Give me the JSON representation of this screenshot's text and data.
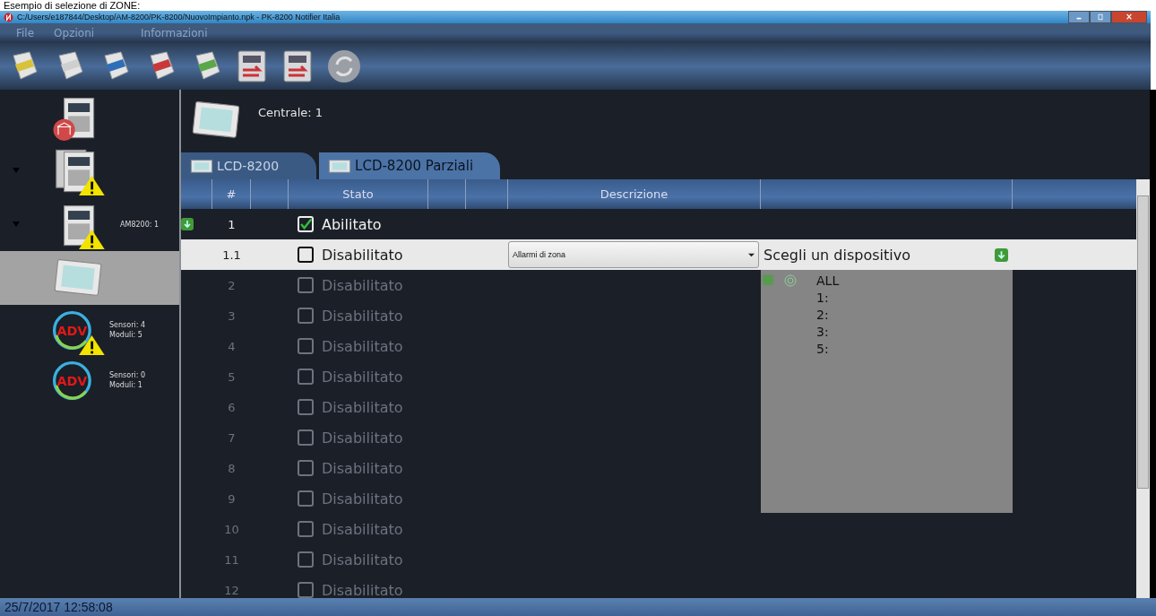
{
  "caption": "Esempio di selezione di ZONE:",
  "window": {
    "title": "C:/Users/e187844/Desktop/AM-8200/PK-8200/NuovoImpianto.npk - PK-8200 Notifier Italia"
  },
  "menu": [
    "File",
    "Opzioni",
    "Informazioni"
  ],
  "toolbar": [
    {
      "kind": "envelope"
    },
    {
      "kind": "probe"
    },
    {
      "kind": "disk"
    },
    {
      "kind": "pdf"
    },
    {
      "kind": "xls"
    },
    {
      "kind": "upload"
    },
    {
      "kind": "download"
    },
    {
      "kind": "sync"
    }
  ],
  "sidebar": {
    "items": [
      {
        "kind": "site",
        "warning": false,
        "expanded": false,
        "selected": false
      },
      {
        "kind": "rack",
        "warning": true,
        "expanded": true,
        "selected": false
      },
      {
        "kind": "panel",
        "warning": true,
        "expanded": true,
        "selected": false,
        "label": "AM8200: 1"
      },
      {
        "kind": "lcd",
        "warning": false,
        "expanded": false,
        "selected": true
      },
      {
        "kind": "adv",
        "icon_text": "ADV",
        "warning": true,
        "expanded": false,
        "selected": false,
        "lines": [
          "Sensori: 4",
          "Moduli: 5"
        ]
      },
      {
        "kind": "adv",
        "icon_text": "ADV",
        "warning": false,
        "expanded": false,
        "selected": false,
        "lines": [
          "Sensori: 0",
          "Moduli: 1"
        ]
      }
    ]
  },
  "header": {
    "title": "Centrale: 1"
  },
  "tabs": [
    {
      "label": "LCD-8200",
      "selected": false
    },
    {
      "label": "LCD-8200 Parziali",
      "selected": true
    }
  ],
  "table": {
    "columns": [
      {
        "label": "#"
      },
      {
        "label": "Stato"
      },
      {
        "label": "Descrizione"
      }
    ],
    "rows": [
      {
        "kind": "zone",
        "number": "1",
        "checked": true,
        "status": "Abilitato",
        "selected": false,
        "dimmed": false
      },
      {
        "kind": "detail",
        "number": "1.1",
        "checked": false,
        "status": "Disabilitato",
        "selected": true,
        "dimmed": false,
        "dropdown": {
          "value": "Allarmi di zona"
        },
        "chooser": {
          "label": "Scegli un dispositivo",
          "options": [
            "ALL",
            "1:",
            "2:",
            "3:",
            "5:"
          ]
        }
      },
      {
        "kind": "plain",
        "number": "2",
        "checked": false,
        "status": "Disabilitato",
        "selected": false,
        "dimmed": true
      },
      {
        "kind": "plain",
        "number": "3",
        "checked": false,
        "status": "Disabilitato",
        "selected": false,
        "dimmed": true
      },
      {
        "kind": "plain",
        "number": "4",
        "checked": false,
        "status": "Disabilitato",
        "selected": false,
        "dimmed": true
      },
      {
        "kind": "plain",
        "number": "5",
        "checked": false,
        "status": "Disabilitato",
        "selected": false,
        "dimmed": true
      },
      {
        "kind": "plain",
        "number": "6",
        "checked": false,
        "status": "Disabilitato",
        "selected": false,
        "dimmed": true
      },
      {
        "kind": "plain",
        "number": "7",
        "checked": false,
        "status": "Disabilitato",
        "selected": false,
        "dimmed": true
      },
      {
        "kind": "plain",
        "number": "8",
        "checked": false,
        "status": "Disabilitato",
        "selected": false,
        "dimmed": true
      },
      {
        "kind": "plain",
        "number": "9",
        "checked": false,
        "status": "Disabilitato",
        "selected": false,
        "dimmed": true
      },
      {
        "kind": "plain",
        "number": "10",
        "checked": false,
        "status": "Disabilitato",
        "selected": false,
        "dimmed": true
      },
      {
        "kind": "plain",
        "number": "11",
        "checked": false,
        "status": "Disabilitato",
        "selected": false,
        "dimmed": true
      },
      {
        "kind": "plain",
        "number": "12",
        "checked": false,
        "status": "Disabilitato",
        "selected": false,
        "dimmed": true
      }
    ]
  },
  "status_bar": {
    "datetime": "25/7/2017  12:58:08"
  }
}
